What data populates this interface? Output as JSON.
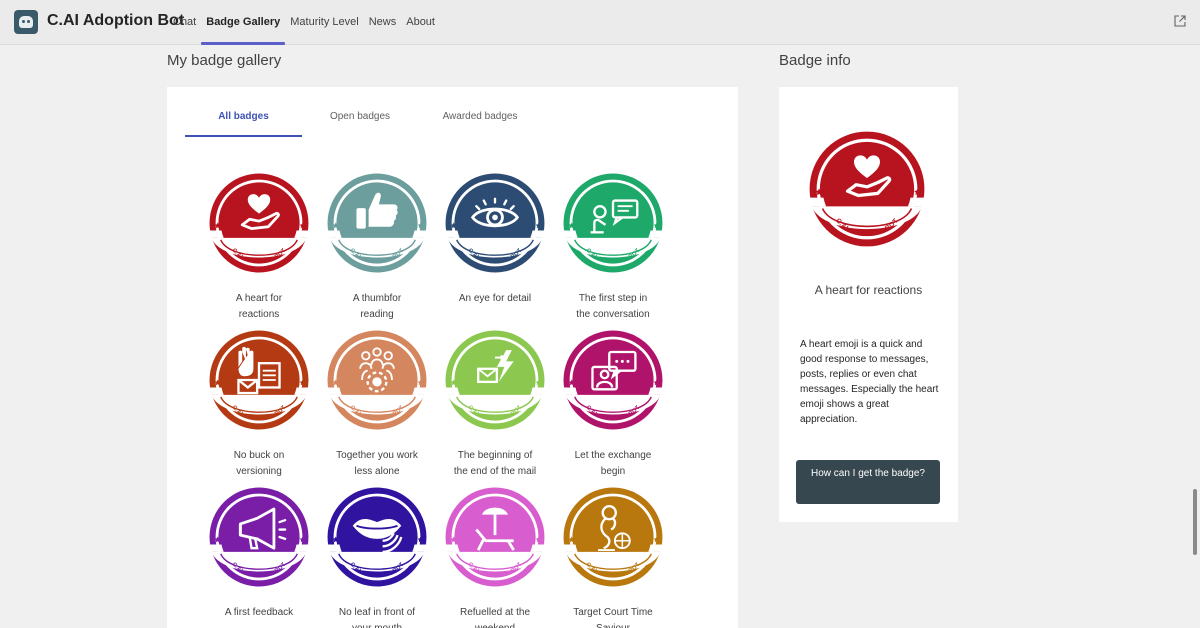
{
  "app": {
    "title": "C.AI Adoption Bot",
    "icon": "bot-icon"
  },
  "nav": [
    "Chat",
    "Badge Gallery",
    "Maturity Level",
    "News",
    "About"
  ],
  "nav_active": "Badge Gallery",
  "gallery": {
    "title": "My badge gallery",
    "tabs": [
      "All badges",
      "Open badges",
      "Awarded badges"
    ],
    "active_tab": "All badges",
    "ribbon_text": "C.AI ADOPTION BOT",
    "badges": [
      {
        "label": "A heart for reactions",
        "lines": [
          "A heart for",
          "reactions"
        ],
        "color": "#b8141f",
        "icon": "heart-hand-icon"
      },
      {
        "label": "A thumbfor reading",
        "lines": [
          "A thumbfor",
          "reading"
        ],
        "color": "#6d9e9e",
        "icon": "thumbs-up-icon"
      },
      {
        "label": "An eye for detail",
        "lines": [
          "An eye for detail"
        ],
        "color": "#2d4c74",
        "icon": "eye-icon"
      },
      {
        "label": "The first step in the conversation",
        "lines": [
          "The first step in",
          "the conversation"
        ],
        "color": "#1ea86a",
        "icon": "conversation-icon"
      },
      {
        "label": "No buck on versioning",
        "lines": [
          "No buck on",
          "versioning"
        ],
        "color": "#b43a14",
        "icon": "hand-documents-icon"
      },
      {
        "label": "Together you work less alone",
        "lines": [
          "Together you work",
          "less alone"
        ],
        "color": "#d4865e",
        "icon": "team-icon"
      },
      {
        "label": "The beginning of the end of the mail",
        "lines": [
          "The beginning of",
          "the end of the mail"
        ],
        "color": "#8cc850",
        "icon": "mail-lightning-icon"
      },
      {
        "label": "Let the exchange begin",
        "lines": [
          "Let the exchange",
          "begin"
        ],
        "color": "#b0146a",
        "icon": "chat-user-icon"
      },
      {
        "label": "A first feedback",
        "lines": [
          "A first feedback"
        ],
        "color": "#7a1ea8",
        "icon": "megaphone-icon"
      },
      {
        "label": "No leaf in front of your mouth",
        "lines": [
          "No leaf in front of",
          "your mouth"
        ],
        "color": "#3014a0",
        "icon": "mouth-icon"
      },
      {
        "label": "Refuelled at the weekend",
        "lines": [
          "Refuelled at the",
          "weekend"
        ],
        "color": "#d85ed0",
        "icon": "beach-chair-icon"
      },
      {
        "label": "Target Court Time Saviour",
        "lines": [
          "Target Court Time",
          "Saviour"
        ],
        "color": "#b8780e",
        "icon": "target-person-icon"
      }
    ]
  },
  "info": {
    "title": "Badge info",
    "badge_name": "A heart for reactions",
    "badge_color": "#b8141f",
    "description": "A heart emoji is a quick and good response to messages, posts, replies or even chat messages. Especially the heart emoji shows a great appreciation.",
    "button_label": "How can I get the badge?"
  }
}
